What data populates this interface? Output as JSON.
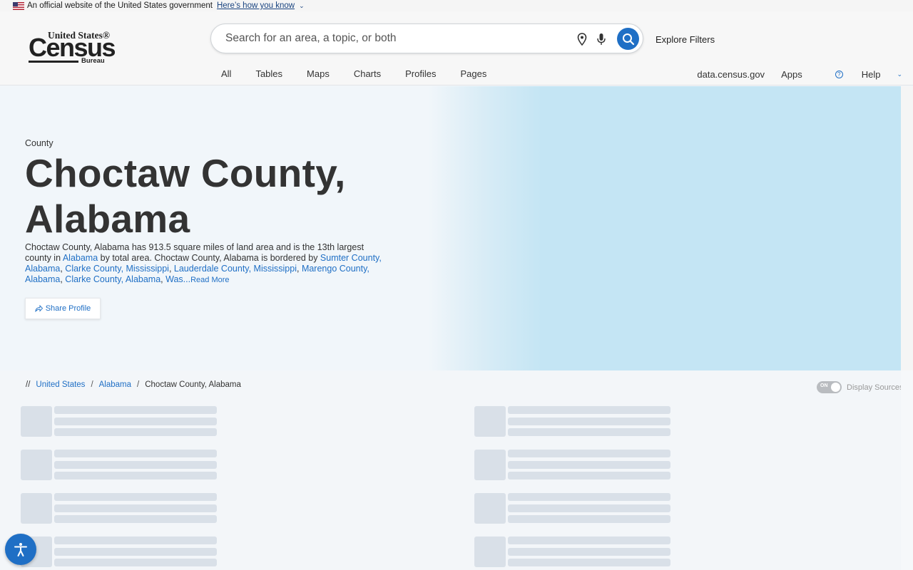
{
  "gov_banner": {
    "text": "An official website of the United States government",
    "link": "Here’s how you know",
    "chevron_icon": "chevron-down-icon"
  },
  "logo": {
    "top": "United States®",
    "main": "Census",
    "bureau": "Bureau"
  },
  "search": {
    "placeholder": "Search for an area, a topic, or both"
  },
  "header": {
    "explore_filters": "Explore Filters",
    "tabs": [
      "All",
      "Tables",
      "Maps",
      "Charts",
      "Profiles",
      "Pages"
    ],
    "utility": {
      "data_link": "data.census.gov",
      "apps": "Apps",
      "help": "Help"
    }
  },
  "hero": {
    "type": "County",
    "title": "Choctaw County, Alabama",
    "desc": {
      "p1": "Choctaw County, Alabama has 913.5 square miles of land area and is the 13th largest county in ",
      "state": "Alabama",
      "p2": " by total area. Choctaw County, Alabama is bordered by ",
      "n1": "Sumter County, Alabama",
      "n2": "Clarke County, Mississippi",
      "n3": "Lauderdale County, Mississippi",
      "n4": "Marengo County, Alabama",
      "n5": "Clarke County, Alabama",
      "n6": "Was...",
      "read_more": "Read More"
    },
    "share": "Share Profile"
  },
  "breadcrumb": {
    "lead": "//",
    "items": [
      "United States",
      "Alabama",
      "Choctaw County, Alabama"
    ],
    "sep": "/"
  },
  "sources_toggle": {
    "state": "ON",
    "label": "Display Sources"
  },
  "colors": {
    "accent": "#1f6fc5",
    "skeleton": "#d9e0e8",
    "hero_right": "#c4e5f4"
  }
}
